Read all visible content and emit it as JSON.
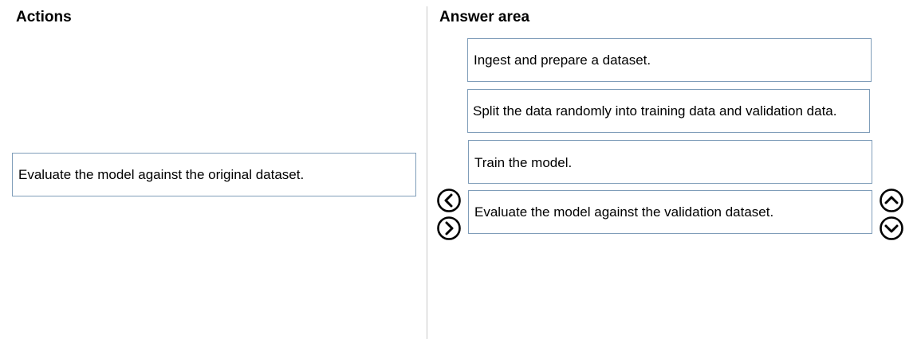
{
  "actions": {
    "heading": "Actions",
    "items": [
      {
        "label": "Evaluate the model against the original dataset."
      }
    ]
  },
  "answer_area": {
    "heading": "Answer area",
    "items": [
      {
        "label": "Ingest and prepare a dataset."
      },
      {
        "label": "Split the data randomly into training data and validation data."
      },
      {
        "label": "Train the model."
      },
      {
        "label": "Evaluate the model against the validation dataset."
      }
    ]
  },
  "controls": {
    "move_left_icon": "chevron-left-circle-icon",
    "move_right_icon": "chevron-right-circle-icon",
    "move_up_icon": "chevron-up-circle-icon",
    "move_down_icon": "chevron-down-circle-icon"
  },
  "colors": {
    "item_border": "#7f9db9",
    "divider": "#c8c8c8",
    "text": "#000000"
  }
}
